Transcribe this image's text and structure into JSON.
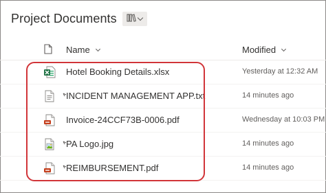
{
  "library": {
    "title": "Project Documents",
    "view_icon": "library-icon"
  },
  "columns": {
    "name": "Name",
    "modified": "Modified"
  },
  "files": [
    {
      "name": "Hotel Booking Details.xlsx",
      "modified": "Yesterday at 12:32 AM",
      "icon": "excel-file-icon",
      "new": false
    },
    {
      "name": "INCIDENT MANAGEMENT APP.txt",
      "modified": "14 minutes ago",
      "icon": "text-file-icon",
      "new": true
    },
    {
      "name": "Invoice-24CCF73B-0006.pdf",
      "modified": "Wednesday at 10:03 PM",
      "icon": "pdf-file-icon",
      "new": false
    },
    {
      "name": "PA Logo.jpg",
      "modified": "14 minutes ago",
      "icon": "image-file-icon",
      "new": true
    },
    {
      "name": "REIMBURSEMENT.pdf",
      "modified": "14 minutes ago",
      "icon": "pdf-file-icon",
      "new": true
    }
  ],
  "colors": {
    "highlight": "#d13438",
    "excel": "#217346",
    "pdf": "#c43e1c"
  }
}
